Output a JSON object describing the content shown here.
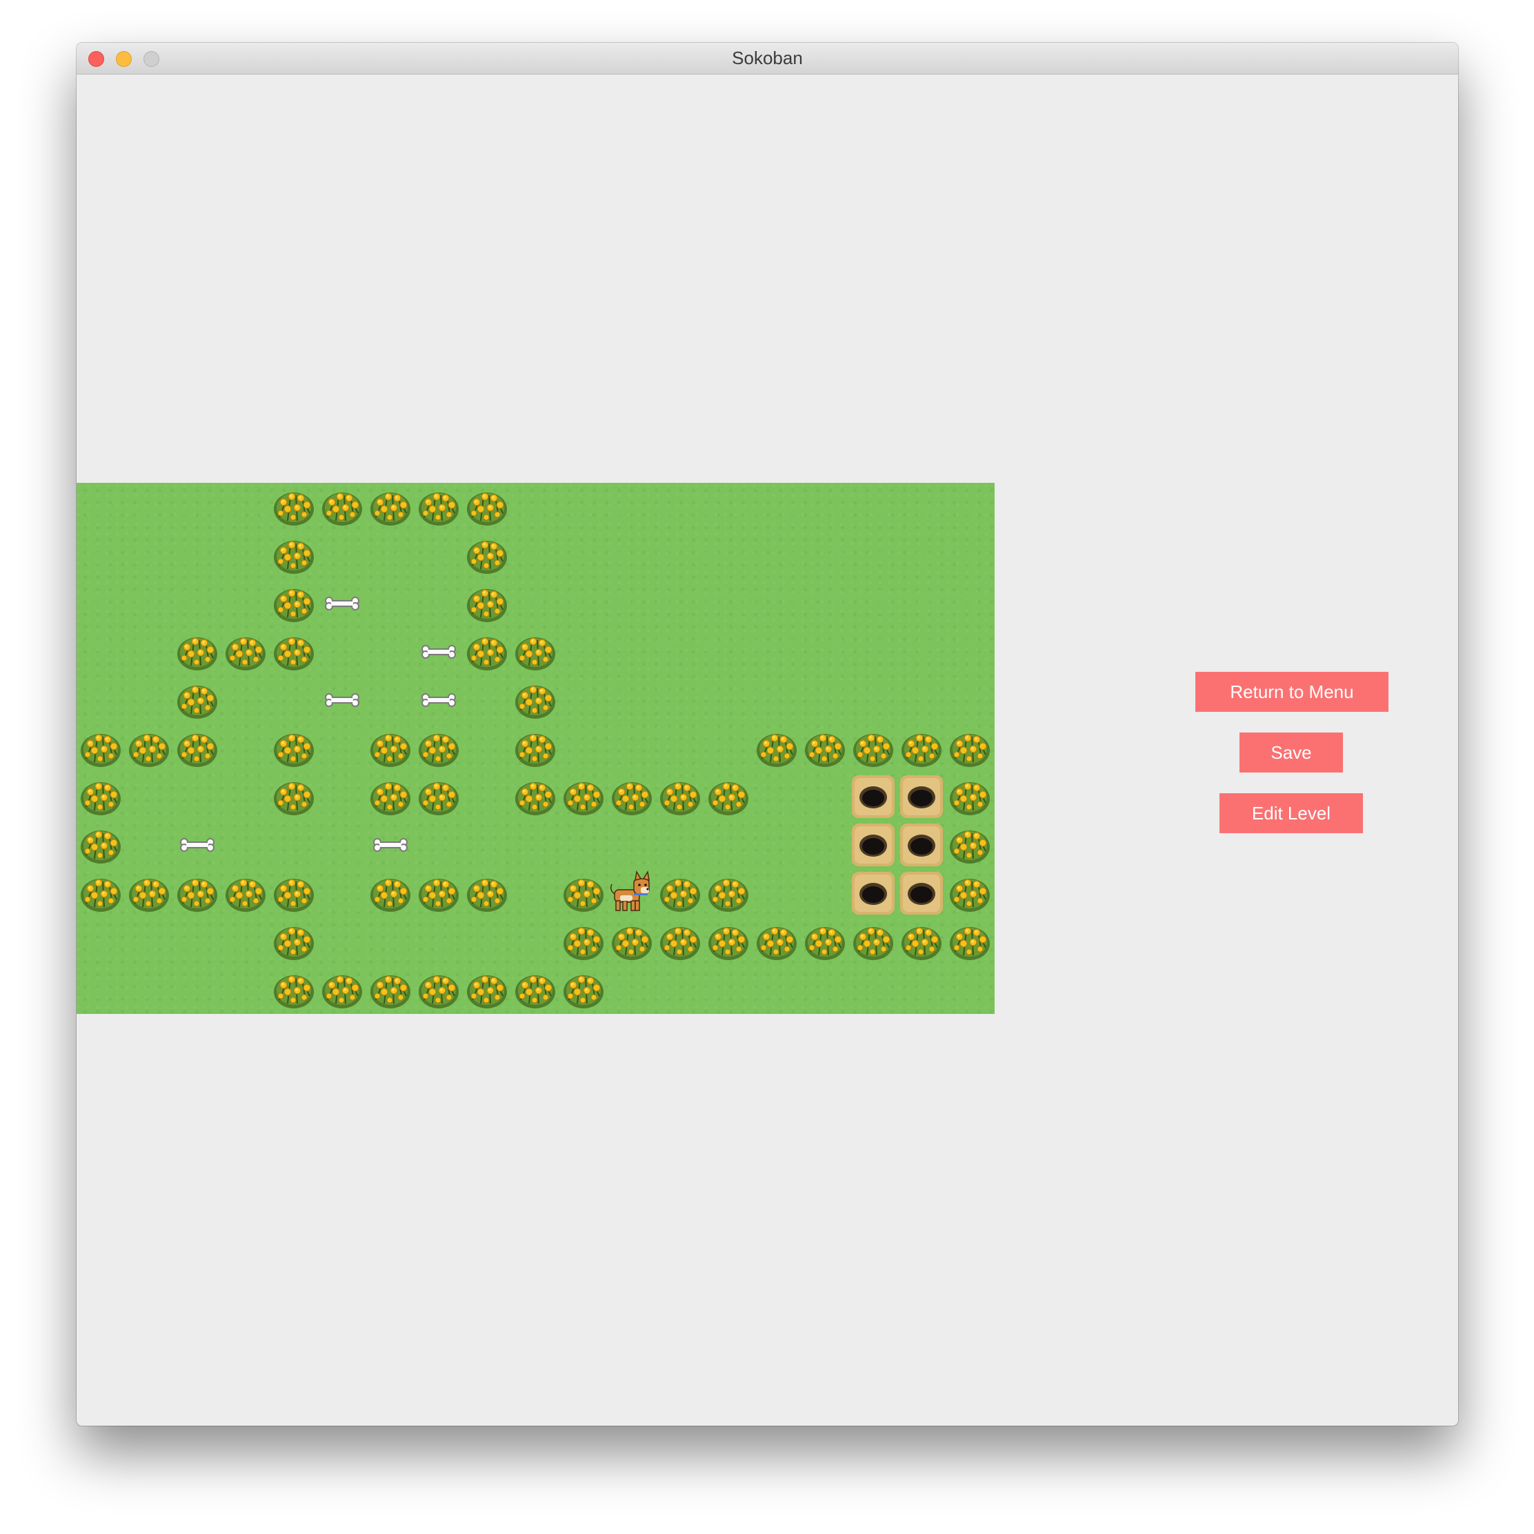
{
  "window": {
    "title": "Sokoban"
  },
  "buttons": {
    "return_to_menu": "Return to Menu",
    "save": "Save",
    "edit_level": "Edit Level"
  },
  "colors": {
    "grass": "#7bc35a",
    "button": "#fb7172",
    "window_bg": "#ededed"
  },
  "board": {
    "rows": 11,
    "cols": 19,
    "legend": {
      "#": "bush-wall",
      "B": "bone-crate",
      "H": "hole-goal",
      "D": "dog-player",
      ".": "grass-floor"
    },
    "grid": [
      "....#####..........",
      "....#...#..........",
      "....#B..#..........",
      "..###..B##.........",
      "..#..B.B.#.........",
      "###.#.##.#....#####",
      "#...#.##.#####..HH#",
      "#.B...B.........HH#",
      "#####.###.#D##..HH#",
      "....#.....#########",
      "....#######........"
    ]
  }
}
